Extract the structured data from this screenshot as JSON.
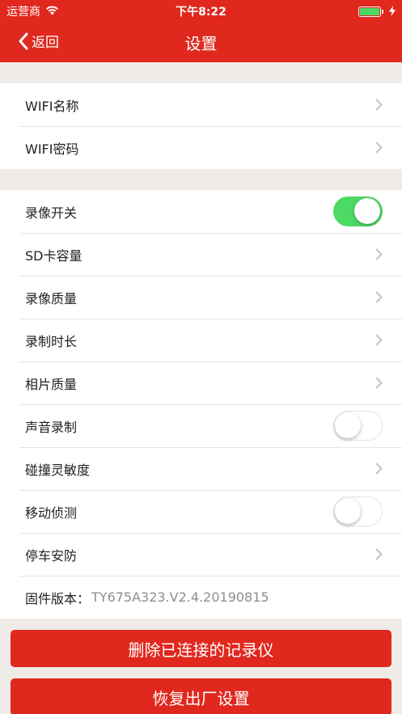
{
  "status_bar": {
    "carrier": "运营商",
    "time": "下午8:22",
    "battery_color": "#4cd964"
  },
  "nav": {
    "back_label": "返回",
    "title": "设置"
  },
  "group1": [
    {
      "label": "WIFI名称",
      "control": "chevron"
    },
    {
      "label": "WIFI密码",
      "control": "chevron"
    }
  ],
  "group2": [
    {
      "label": "录像开关",
      "control": "toggle",
      "on": true
    },
    {
      "label": "SD卡容量",
      "control": "chevron"
    },
    {
      "label": "录像质量",
      "control": "chevron"
    },
    {
      "label": "录制时长",
      "control": "chevron"
    },
    {
      "label": "相片质量",
      "control": "chevron"
    },
    {
      "label": "声音录制",
      "control": "toggle",
      "on": false
    },
    {
      "label": "碰撞灵敏度",
      "control": "chevron"
    },
    {
      "label": "移动侦测",
      "control": "toggle",
      "on": false
    },
    {
      "label": "停车安防",
      "control": "chevron"
    },
    {
      "label": "固件版本：",
      "value": "TY675A323.V2.4.20190815",
      "control": "none"
    }
  ],
  "buttons": {
    "delete_label": "删除已连接的记录仪",
    "reset_label": "恢复出厂设置"
  },
  "colors": {
    "brand_red": "#e0281e",
    "toggle_on": "#4cd964",
    "background": "#efebe6"
  },
  "icons": [
    "wifi-icon",
    "battery-icon",
    "charging-icon",
    "back-chevron-icon",
    "chevron-right-icon"
  ]
}
